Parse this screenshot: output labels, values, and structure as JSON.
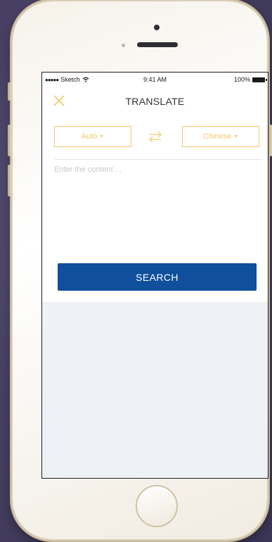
{
  "status_bar": {
    "carrier": "Sketch",
    "time": "9:41 AM",
    "battery": "100%"
  },
  "nav": {
    "title": "TRANSLATE",
    "close_icon": "close-icon"
  },
  "languages": {
    "from": "Auto",
    "to": "Chinese",
    "swap_icon": "swap-icon"
  },
  "input": {
    "placeholder": "Enter the content ...",
    "value": ""
  },
  "search_button": {
    "label": "SEARCH"
  },
  "colors": {
    "accent": "#f2c96b",
    "primary_button": "#0f4f9c",
    "background": "#eef1f6"
  }
}
